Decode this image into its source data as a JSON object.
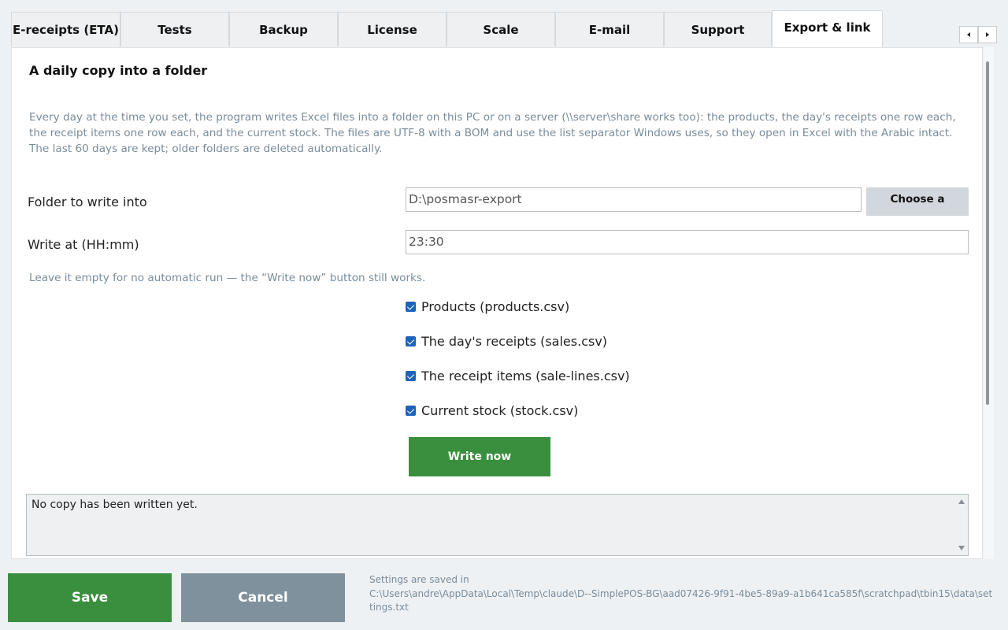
{
  "tabs": [
    {
      "label": "E-receipts (ETA)"
    },
    {
      "label": "Tests"
    },
    {
      "label": "Backup"
    },
    {
      "label": "License"
    },
    {
      "label": "Scale"
    },
    {
      "label": "E-mail"
    },
    {
      "label": "Support"
    },
    {
      "label": "Export & link",
      "active": true
    }
  ],
  "section": {
    "title": "A daily copy into a folder",
    "description": "Every day at the time you set, the program writes Excel files into a folder on this PC or on a server (\\\\server\\share works too): the products, the day's receipts one row each, the receipt items one row each, and the current stock. The files are UTF-8 with a BOM and use the list separator Windows uses, so they open in Excel with the Arabic intact. The last 60 days are kept; older folders are deleted automatically."
  },
  "folder": {
    "label": "Folder to write into",
    "value": "D:\\posmasr-export",
    "choose_label": "Choose a"
  },
  "time": {
    "label": "Write at (HH:mm)",
    "value": "23:30",
    "hint": "Leave it empty for no automatic run — the “Write now” button still works."
  },
  "checks": [
    {
      "label": "Products (products.csv)",
      "checked": true
    },
    {
      "label": "The day's receipts (sales.csv)",
      "checked": true
    },
    {
      "label": "The receipt items (sale-lines.csv)",
      "checked": true
    },
    {
      "label": "Current stock (stock.csv)",
      "checked": true
    }
  ],
  "write_now_label": "Write now",
  "log": {
    "text": "No copy has been written yet."
  },
  "footer": {
    "save_label": "Save",
    "cancel_label": "Cancel",
    "saved_label": "Settings are saved in",
    "saved_path": "C:\\Users\\andre\\AppData\\Local\\Temp\\claude\\D--SimplePOS-BG\\aad07426-9f91-4be5-89a9-a1b641ca585f\\scratchpad\\tbin15\\data\\settings.txt"
  },
  "colors": {
    "accent_green": "#3a8f3f",
    "cancel_gray": "#7f919c",
    "checkbox_blue": "#1d64b8",
    "muted_text": "#7a8c9b"
  }
}
